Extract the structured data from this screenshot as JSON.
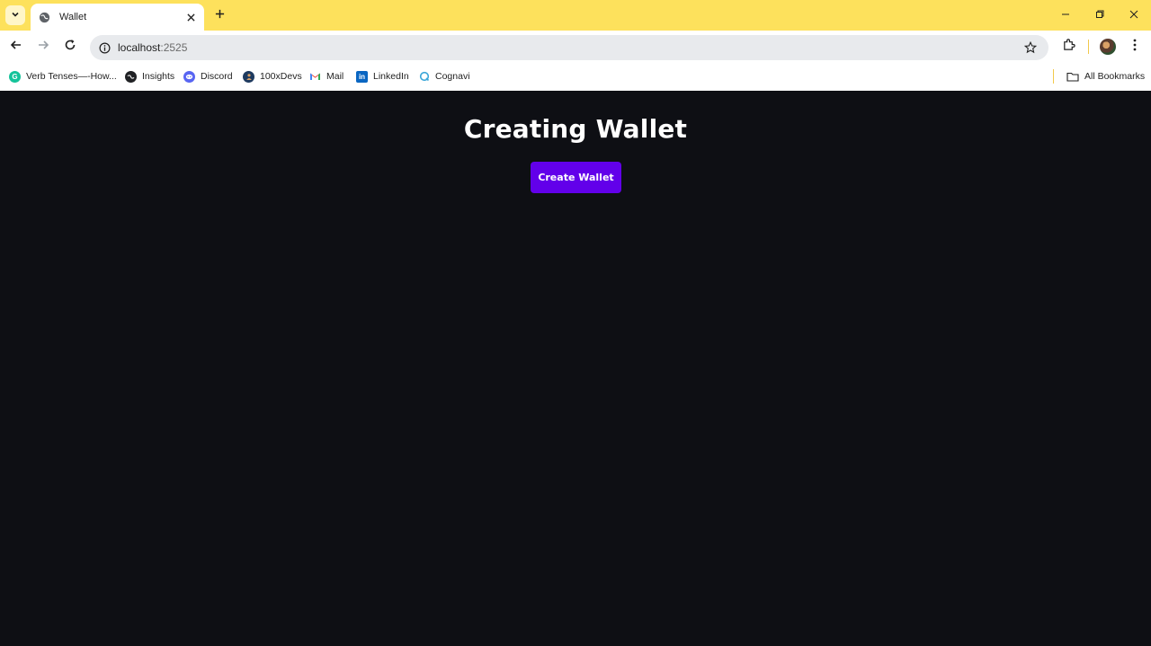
{
  "browser": {
    "tab": {
      "title": "Wallet",
      "favicon": "globe-icon"
    },
    "url": {
      "host": "localhost",
      "port": ":2525"
    },
    "bookmarks": [
      {
        "label": "Verb Tenses—-How...",
        "icon": "grammarly-icon",
        "color": "#15c39a"
      },
      {
        "label": "Insights",
        "icon": "globe-icon",
        "color": "#202124"
      },
      {
        "label": "Discord",
        "icon": "discord-icon",
        "color": "#5865f2"
      },
      {
        "label": "100xDevs",
        "icon": "avatar-icon",
        "color": "#1e3a5f"
      },
      {
        "label": "Mail",
        "icon": "gmail-icon",
        "color": "#ea4335"
      },
      {
        "label": "LinkedIn",
        "icon": "linkedin-icon",
        "color": "#0a66c2"
      },
      {
        "label": "Cognavi",
        "icon": "cognavi-icon",
        "color": "#3aa6d8"
      }
    ],
    "all_bookmarks_label": "All Bookmarks",
    "theme_color": "#fde15c"
  },
  "page": {
    "title": "Creating Wallet",
    "create_button_label": "Create Wallet",
    "background_color": "#0e0f14",
    "accent_color": "#6200ea"
  }
}
